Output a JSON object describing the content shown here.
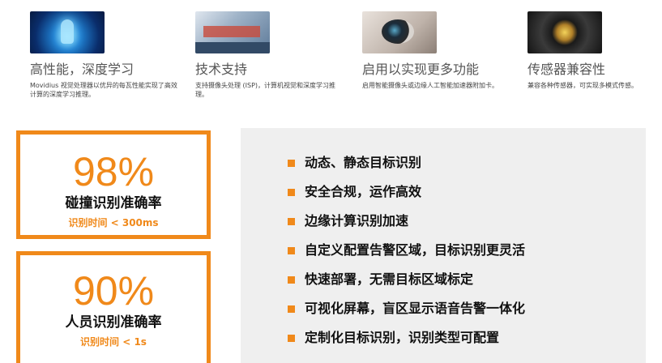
{
  "features": [
    {
      "icon": "ai-chip-icon",
      "title": "高性能，深度学习",
      "desc": "Movidius 视觉处理器以优异的每瓦性能实现了高效计算的深度学习推理。"
    },
    {
      "icon": "isp-icon",
      "title": "技术支持",
      "desc": "支持摄像头处理 (ISP)，计算机视觉和深度学习推理。"
    },
    {
      "icon": "camera-icon",
      "title": "启用以实现更多功能",
      "desc": "启用智能摄像头或边缘人工智能加速器附加卡。"
    },
    {
      "icon": "lens-icon",
      "title": "传感器兼容性",
      "desc": "兼容各种传感器，可实现多模式传感。"
    }
  ],
  "stats": [
    {
      "value": "98%",
      "label": "碰撞识别准确率",
      "time": "识别时间 < 300ms"
    },
    {
      "value": "90%",
      "label": "人员识别准确率",
      "time": "识别时间 < 1s"
    }
  ],
  "list": [
    "动态、静态目标识别",
    "安全合规，运作高效",
    "边缘计算识别加速",
    "自定义配置告警区域，目标识别更灵活",
    "快速部署，无需目标区域标定",
    "可视化屏幕，盲区显示语音告警一体化",
    "定制化目标识别，识别类型可配置"
  ],
  "colors": {
    "accent": "#f0891a",
    "panel_bg": "#efefef"
  }
}
